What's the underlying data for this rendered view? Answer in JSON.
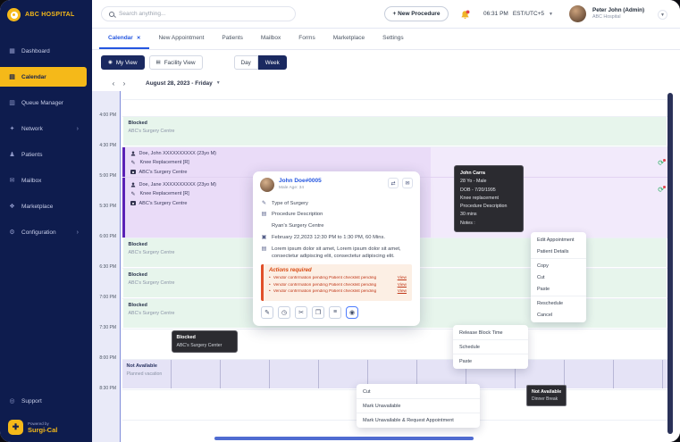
{
  "sidebar": {
    "logo_text": "ABC HOSPITAL",
    "items": [
      {
        "label": "Dashboard",
        "icon": "dashboard-icon"
      },
      {
        "label": "Calendar",
        "icon": "calendar-icon"
      },
      {
        "label": "Queue Manager",
        "icon": "queue-manager-icon"
      },
      {
        "label": "Network",
        "icon": "network-icon"
      },
      {
        "label": "Patients",
        "icon": "patients-icon"
      },
      {
        "label": "Mailbox",
        "icon": "mailbox-icon"
      },
      {
        "label": "Marketplace",
        "icon": "marketplace-icon"
      },
      {
        "label": "Configuration",
        "icon": "configuration-icon"
      }
    ],
    "support_label": "Support",
    "powered_by": "Powered by",
    "brand": "Surgi-Cal"
  },
  "topbar": {
    "search_placeholder": "Search anything...",
    "new_procedure_label": "+ New Procedure",
    "time": "06:31 PM",
    "timezone": "EST/UTC+5",
    "user_name": "Peter John (Admin)",
    "user_org": "ABC Hospital"
  },
  "tabs": {
    "items": [
      {
        "label": "Calendar",
        "close": "✕"
      },
      {
        "label": "New Appointment"
      },
      {
        "label": "Patients"
      },
      {
        "label": "Mailbox"
      },
      {
        "label": "Forms"
      },
      {
        "label": "Marketplace"
      },
      {
        "label": "Settings"
      }
    ]
  },
  "viewbar": {
    "my_view": "My View",
    "facility_view": "Facility View",
    "day": "Day",
    "week": "Week"
  },
  "datebar": {
    "prev": "‹",
    "next": "›",
    "date_label": "August 28, 2023 - Friday"
  },
  "calendar": {
    "times": [
      "4:00 PM",
      "4:30 PM",
      "5:00 PM",
      "5:30 PM",
      "6:00 PM",
      "6:30 PM",
      "7:00 PM",
      "7:30 PM",
      "8:00 PM",
      "8:30 PM"
    ],
    "blocked_events": [
      {
        "title": "Blocked",
        "subtitle": "ABC's Surgery Centre"
      },
      {
        "title": "Blocked",
        "subtitle": "ABC's Surgery Centre"
      },
      {
        "title": "Blocked",
        "subtitle": "ABC's Surgery Centre"
      },
      {
        "title": "Blocked",
        "subtitle": "ABC's Surgery Centre"
      }
    ],
    "appointments": [
      {
        "patient": "Doe, John XXXXXXXXXX (23yo M)",
        "procedure": "Knee Replacement [R]",
        "facility": "ABC's Surgery Centre"
      },
      {
        "patient": "Doe, Jane XXXXXXXXXX (23yo M)",
        "procedure": "Knee Replacement [R]",
        "facility": "ABC's Surgery Centre"
      }
    ],
    "not_available": {
      "title": "Not Available",
      "subtitle": "Planned vacation"
    },
    "blocked_tooltip": {
      "title": "Blocked",
      "subtitle": "ABC's Surgery Center"
    }
  },
  "popup": {
    "name": "John Doe#0005",
    "meta": "Male Age: 34",
    "rows": [
      {
        "label": "Type of Surgery",
        "icon": "pencil-icon"
      },
      {
        "label": "Procedure Description",
        "icon": "clipboard-icon"
      },
      {
        "label": "Ryan's Surgery Centre",
        "icon": "facility-icon"
      },
      {
        "label": "February 22,2023 12:30 PM to 1:30 PM, 60 Mins.",
        "icon": "calendar-icon"
      },
      {
        "label": "Lorem ipsum dolor sit amet, Lorem ipsum dolor sit amet, consectetur adipiscing elit, consectetur adipiscing elit.",
        "icon": "document-icon"
      }
    ],
    "actions": {
      "title": "Actions required",
      "items": [
        {
          "text": "Vendor confirmation pending Patient checklist pending",
          "link": "View"
        },
        {
          "text": "Vendor confirmation pending Patient checklist pending",
          "link": "View"
        },
        {
          "text": "Vendor confirmation pending Patient checklist pending",
          "link": "View"
        }
      ]
    }
  },
  "patient_tooltip": {
    "lines": [
      "John Carra",
      "28 Yo - Male",
      "DOB - 7/20/1995",
      "Knee replacement",
      "Procedure Description",
      "30 mins",
      "Notes :"
    ]
  },
  "context_menu": {
    "items": [
      "Edit Appointment",
      "Patient Details",
      "Copy",
      "Cut",
      "Paste",
      "Reschedule",
      "Cancel"
    ]
  },
  "block_menu": {
    "items": [
      "Release Block Time",
      "Schedule",
      "Paste"
    ]
  },
  "unavailable_menu": {
    "items": [
      "Cut",
      "Mark Unavailable",
      "Mark Unavailable & Request Appointment"
    ]
  },
  "dinner_break": {
    "title": "Not Available",
    "subtitle": "Dinner Break"
  },
  "colors": {
    "accent_yellow": "#F5B919",
    "sidebar_navy": "#0E1C4E",
    "primary_blue": "#2456E0",
    "green_event": "#E7F5EC",
    "purple_event": "#EADCF8",
    "alert_orange": "#D9480F",
    "sync_green": "#27AE60"
  }
}
